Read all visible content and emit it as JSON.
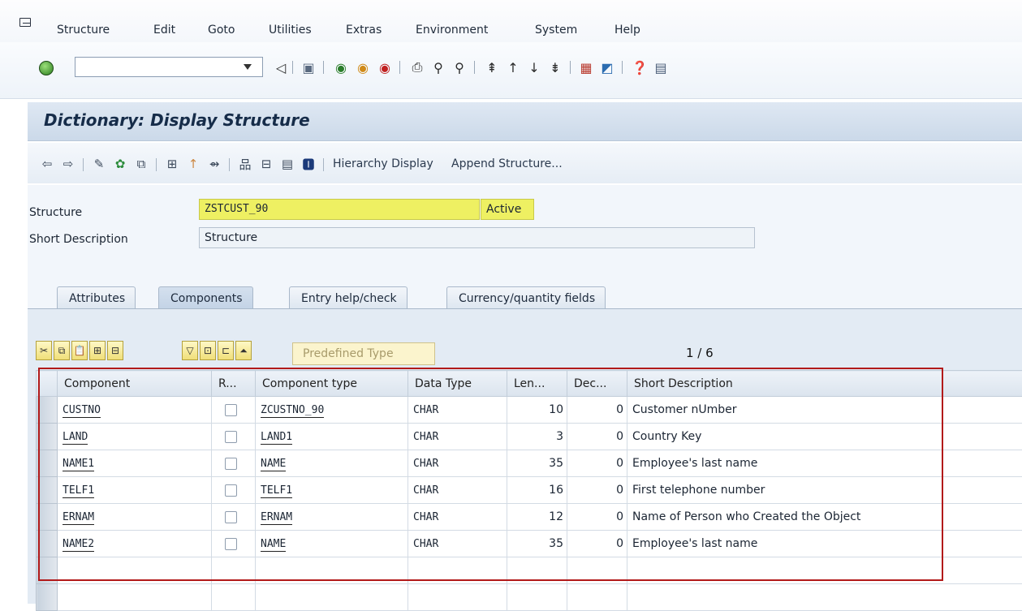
{
  "menubar": {
    "items": [
      {
        "label": "Structure"
      },
      {
        "label": "Edit"
      },
      {
        "label": "Goto"
      },
      {
        "label": "Utilities"
      },
      {
        "label": "Extras"
      },
      {
        "label": "Environment"
      },
      {
        "label": "System"
      },
      {
        "label": "Help"
      }
    ]
  },
  "standard_toolbar": {
    "command_field": "",
    "icons": [
      "enter-icon",
      "back-icon",
      "save-icon",
      "exit-icon",
      "cancel-icon",
      "print-icon",
      "find-icon",
      "find-next-icon",
      "first-page-icon",
      "previous-page-icon",
      "next-page-icon",
      "last-page-icon",
      "create-session-icon",
      "shortcut-icon",
      "help-icon",
      "customize-layout-icon"
    ]
  },
  "title": "Dictionary: Display Structure",
  "app_toolbar": {
    "icons": [
      "back-arrow-icon",
      "forward-arrow-icon",
      "display-change-icon",
      "check-icon",
      "activate-icon",
      "where-used-icon",
      "object-list-icon",
      "navigation-window-icon",
      "hierarchy-icon",
      "graphic-icon",
      "list-icon",
      "info-icon"
    ],
    "hierarchy_display": "Hierarchy Display",
    "append_structure": "Append Structure..."
  },
  "header": {
    "structure_label": "Structure",
    "structure_value": "ZSTCUST_90",
    "status": "Active",
    "short_desc_label": "Short Description",
    "short_desc_value": "Structure"
  },
  "tabs": [
    {
      "label": "Attributes",
      "active": false
    },
    {
      "label": "Components",
      "active": true
    },
    {
      "label": "Entry help/check",
      "active": false
    },
    {
      "label": "Currency/quantity fields",
      "active": false
    }
  ],
  "table_toolbar": {
    "predefined_type": "Predefined Type",
    "pager": "1 / 6"
  },
  "grid": {
    "columns": [
      "Component",
      "R...",
      "Component type",
      "Data Type",
      "Len...",
      "Dec...",
      "Short Description"
    ],
    "rows": [
      {
        "component": "CUSTNO",
        "type": "ZCUSTNO_90",
        "data_type": "CHAR",
        "length": "10",
        "decimals": "0",
        "desc": "Customer nUmber"
      },
      {
        "component": "LAND",
        "type": "LAND1",
        "data_type": "CHAR",
        "length": "3",
        "decimals": "0",
        "desc": "Country Key"
      },
      {
        "component": "NAME1",
        "type": "NAME",
        "data_type": "CHAR",
        "length": "35",
        "decimals": "0",
        "desc": "Employee's last name"
      },
      {
        "component": "TELF1",
        "type": "TELF1",
        "data_type": "CHAR",
        "length": "16",
        "decimals": "0",
        "desc": "First telephone number"
      },
      {
        "component": "ERNAM",
        "type": "ERNAM",
        "data_type": "CHAR",
        "length": "12",
        "decimals": "0",
        "desc": "Name of Person who Created the Object"
      },
      {
        "component": "NAME2",
        "type": "NAME",
        "data_type": "CHAR",
        "length": "35",
        "decimals": "0",
        "desc": "Employee's last name"
      }
    ]
  },
  "colors": {
    "highlight": "#eef062",
    "annotation_box": "#b21a1a",
    "title_bar": "#cbd9e9"
  }
}
